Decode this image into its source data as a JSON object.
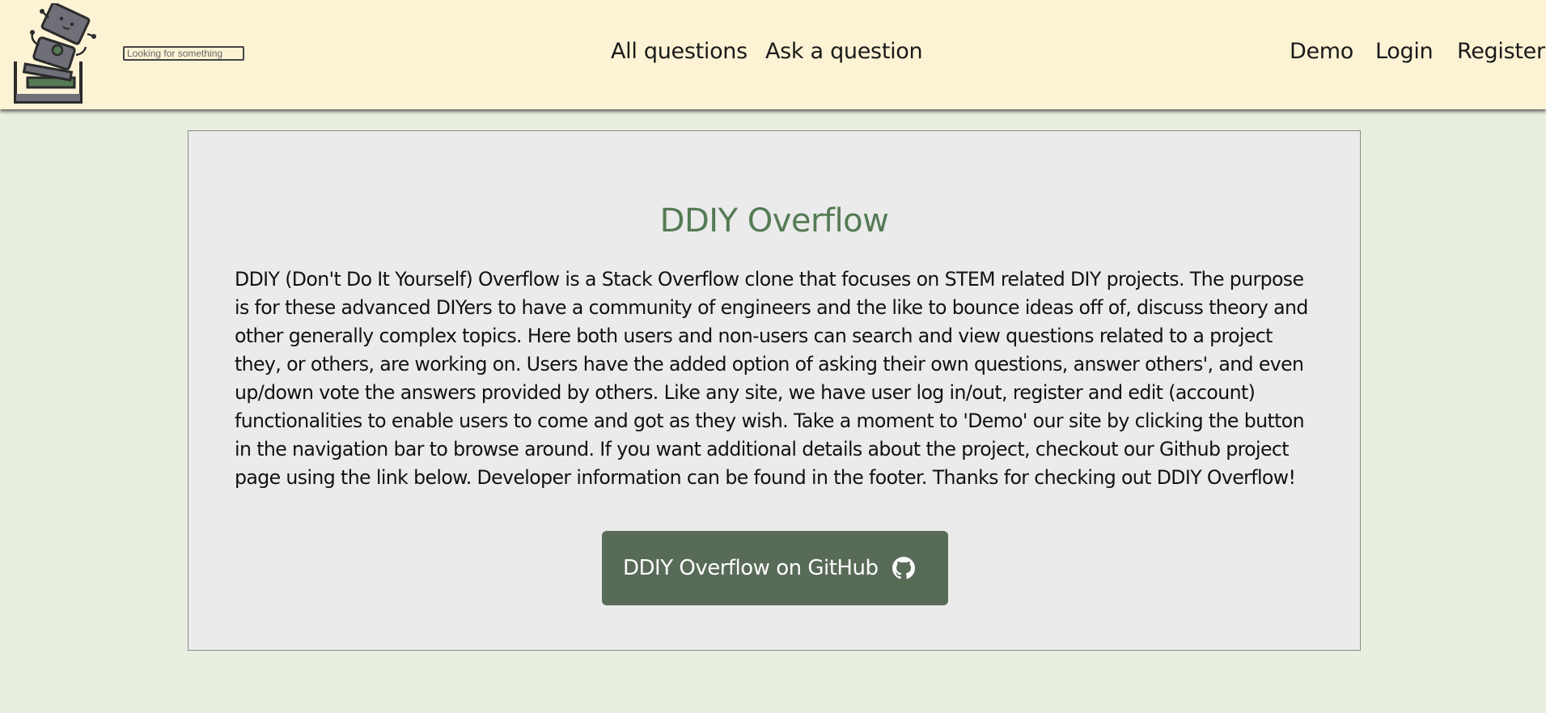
{
  "header": {
    "search": {
      "placeholder": "Looking for something",
      "value": ""
    },
    "nav_center": [
      {
        "label": "All questions"
      },
      {
        "label": "Ask a question"
      }
    ],
    "nav_right": [
      {
        "label": "Demo"
      },
      {
        "label": "Login"
      },
      {
        "label": "Register"
      }
    ]
  },
  "main": {
    "title": "DDIY Overflow",
    "description": "DDIY (Don't Do It Yourself) Overflow is a Stack Overflow clone that focuses on STEM related DIY projects. The purpose is for these advanced DIYers to have a community of engineers and the like to bounce ideas off of, discuss theory and other generally complex topics. Here both users and non-users can search and view questions related to a project they, or others, are working on. Users have the added option of asking their own questions, answer others', and even up/down vote the answers provided by others. Like any site, we have user log in/out, register and edit (account) functionalities to enable users to come and got as they wish. Take a moment to 'Demo' our site by clicking the button in the navigation bar to browse around. If you want additional details about the project, checkout our Github project page using the link below. Developer information can be found in the footer. Thanks for checking out DDIY Overflow!",
    "github_button": {
      "label": "DDIY Overflow on GitHub",
      "icon": "github-icon"
    }
  },
  "colors": {
    "navbar_bg": "#fcf3d5",
    "page_bg": "#e8efe0",
    "card_bg": "#ebebeb",
    "title_green": "#557a55",
    "button_green": "#586b57"
  },
  "logo": {
    "icon": "robot-stack-logo"
  }
}
